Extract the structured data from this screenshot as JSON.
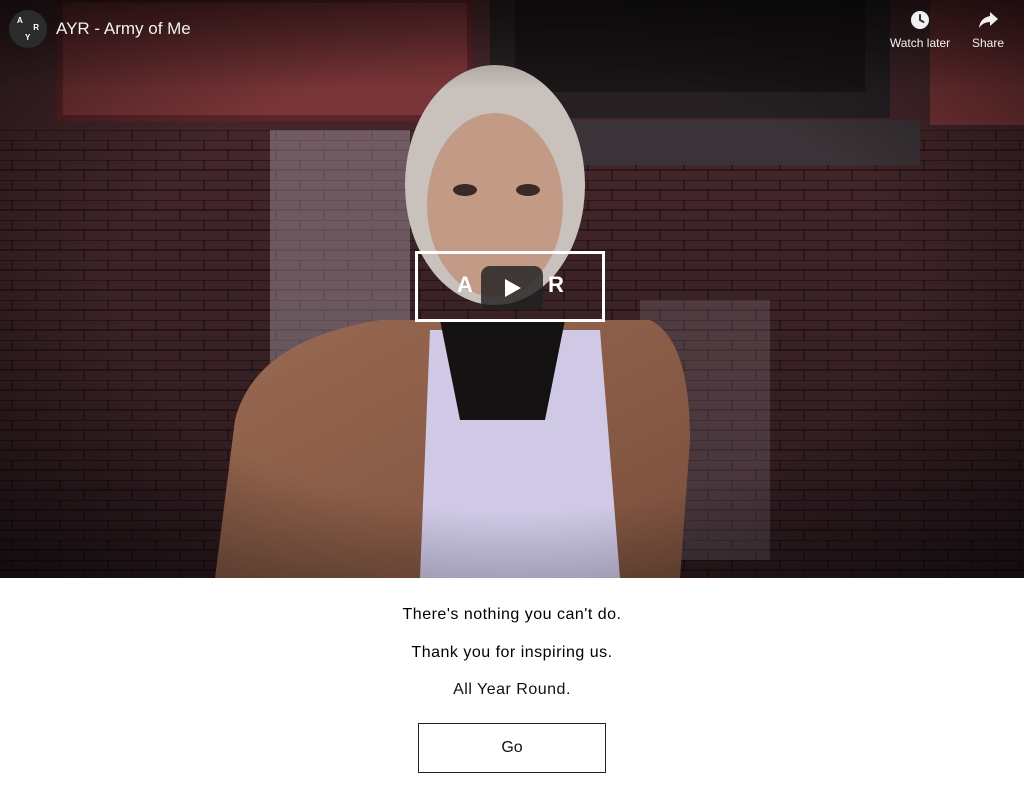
{
  "video": {
    "channel_avatar": {
      "letters": [
        "A",
        "R",
        "Y"
      ]
    },
    "title": "AYR - Army of Me",
    "actions": {
      "watch_later": {
        "label": "Watch later",
        "icon": "clock-icon"
      },
      "share": {
        "label": "Share",
        "icon": "share-arrow-icon"
      }
    },
    "overlay_logo": {
      "letter_left": "A",
      "letter_right": "R"
    },
    "play_button": {
      "icon": "play-icon"
    }
  },
  "message": {
    "line1": "There's nothing you can't do.",
    "line2": "Thank you for inspiring us.",
    "line3": "All Year Round."
  },
  "cta": {
    "go_label": "Go"
  },
  "colors": {
    "background": "#ffffff",
    "text": "#1f1f1f",
    "button_border": "#222222",
    "overlay_text": "#f1f1f1"
  }
}
